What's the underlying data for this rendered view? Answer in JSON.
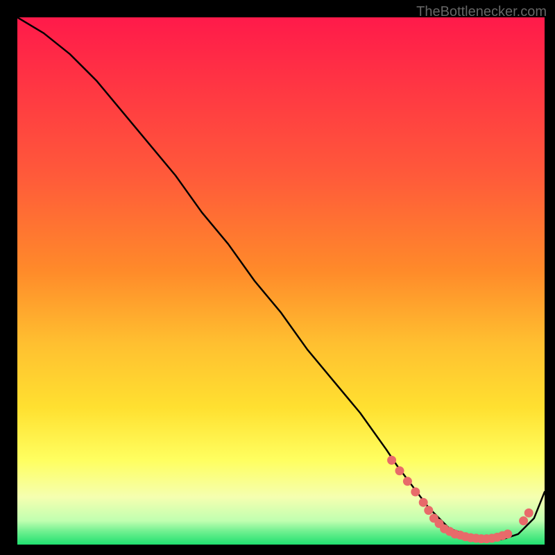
{
  "watermark": "TheBottlenecker.com",
  "chart_data": {
    "type": "line",
    "title": "",
    "xlabel": "",
    "ylabel": "",
    "xlim": [
      0,
      100
    ],
    "ylim": [
      0,
      100
    ],
    "background_gradient": {
      "top": "#ff1a4a",
      "mid_upper": "#ff8a2a",
      "mid": "#ffe030",
      "mid_lower": "#ffff60",
      "lower": "#f5ffb0",
      "bottom": "#20e070"
    },
    "series": [
      {
        "name": "bottleneck-curve",
        "color": "#000000",
        "x": [
          0,
          5,
          10,
          15,
          20,
          25,
          30,
          35,
          40,
          45,
          50,
          55,
          60,
          65,
          70,
          72,
          75,
          78,
          80,
          82,
          85,
          88,
          90,
          92,
          95,
          98,
          100
        ],
        "y": [
          100,
          97,
          93,
          88,
          82,
          76,
          70,
          63,
          57,
          50,
          44,
          37,
          31,
          25,
          18,
          15,
          11,
          7,
          5,
          3,
          2,
          1,
          1,
          1,
          2,
          5,
          10
        ]
      }
    ],
    "markers": {
      "color": "#e86a6a",
      "points": [
        {
          "x": 71,
          "y": 16
        },
        {
          "x": 72.5,
          "y": 14
        },
        {
          "x": 74,
          "y": 12
        },
        {
          "x": 75.5,
          "y": 10
        },
        {
          "x": 77,
          "y": 8
        },
        {
          "x": 78,
          "y": 6.5
        },
        {
          "x": 79,
          "y": 5
        },
        {
          "x": 80,
          "y": 4
        },
        {
          "x": 81,
          "y": 3
        },
        {
          "x": 82,
          "y": 2.5
        },
        {
          "x": 83,
          "y": 2
        },
        {
          "x": 84,
          "y": 1.8
        },
        {
          "x": 85,
          "y": 1.5
        },
        {
          "x": 86,
          "y": 1.3
        },
        {
          "x": 87,
          "y": 1.2
        },
        {
          "x": 88,
          "y": 1.1
        },
        {
          "x": 89,
          "y": 1.1
        },
        {
          "x": 90,
          "y": 1.2
        },
        {
          "x": 91,
          "y": 1.4
        },
        {
          "x": 92,
          "y": 1.7
        },
        {
          "x": 93,
          "y": 2.0
        },
        {
          "x": 96,
          "y": 4.5
        },
        {
          "x": 97,
          "y": 6
        }
      ]
    }
  }
}
